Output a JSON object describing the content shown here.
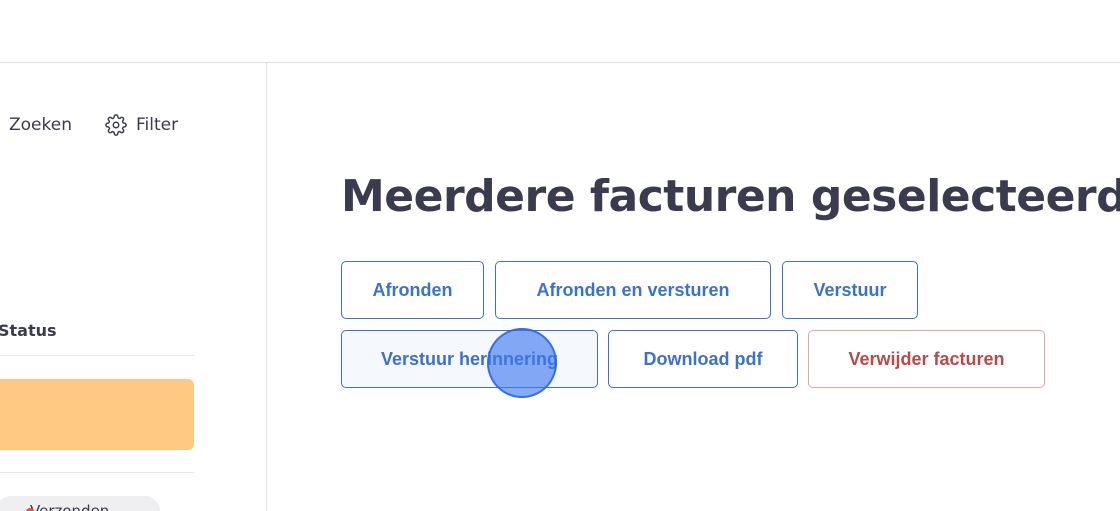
{
  "sidebar": {
    "search_label": "Zoeken",
    "filter_label": "Filter",
    "filter_icon": "gear-icon",
    "status_header": "Status",
    "row_highlight_color": "#ffc883",
    "status_pill_label": "Verzonden",
    "status_pill_dot_color": "#e5533d"
  },
  "main": {
    "title": "Meerdere facturen geselecteerd",
    "actions": {
      "finalize": "Afronden",
      "finalize_and_send": "Afronden en versturen",
      "send": "Verstuur",
      "send_reminder": "Verstuur herinnering",
      "download_pdf": "Download pdf",
      "delete_invoices": "Verwijder facturen"
    }
  },
  "colors": {
    "accent": "#3d72c8",
    "danger": "#b94a4a",
    "text": "#3b3b4f"
  },
  "cursor": {
    "icon": "click-indicator"
  }
}
